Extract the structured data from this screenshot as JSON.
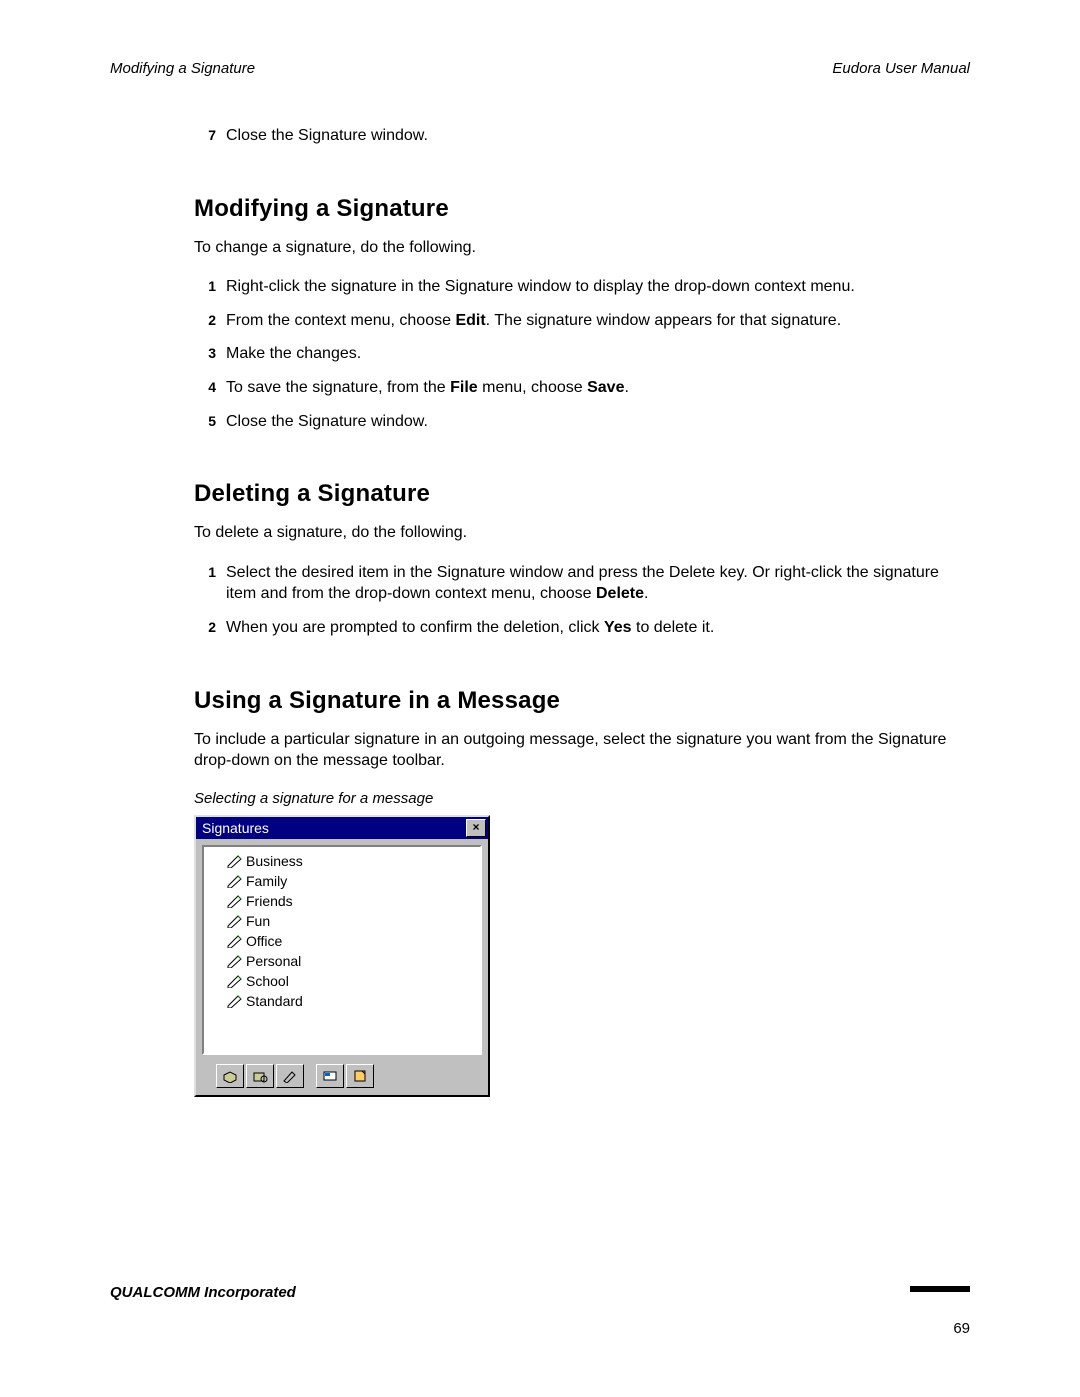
{
  "header": {
    "left": "Modifying a Signature",
    "right": "Eudora User Manual"
  },
  "top_step": {
    "num": "7",
    "text": "Close the Signature window."
  },
  "sections": {
    "modify": {
      "heading": "Modifying a Signature",
      "intro": "To change a signature, do the following.",
      "steps": [
        {
          "num": "1",
          "text": "Right-click the signature in the Signature window to display the drop-down context menu."
        },
        {
          "num": "2",
          "pre": "From the context menu, choose ",
          "b1": "Edit",
          "post": ". The signature window appears for that signature."
        },
        {
          "num": "3",
          "text": "Make the changes."
        },
        {
          "num": "4",
          "pre": "To save the signature, from the ",
          "b1": "File",
          "mid": " menu, choose ",
          "b2": "Save",
          "post": "."
        },
        {
          "num": "5",
          "text": "Close the Signature window."
        }
      ]
    },
    "delete": {
      "heading": "Deleting a Signature",
      "intro": "To delete a signature, do the following.",
      "steps": [
        {
          "num": "1",
          "pre": "Select the desired item in the Signature window and press the Delete key. Or right-click the signature item and from the drop-down context menu, choose ",
          "b1": "Delete",
          "post": "."
        },
        {
          "num": "2",
          "pre": "When you are prompted to confirm the deletion, click ",
          "b1": "Yes",
          "post": " to delete it."
        }
      ]
    },
    "using": {
      "heading": "Using a Signature in a Message",
      "intro": "To include a particular signature in an outgoing message, select the signature you want from the Signature drop-down on the message toolbar.",
      "caption": "Selecting a signature for a message"
    }
  },
  "sig_panel": {
    "title": "Signatures",
    "close": "×",
    "items": [
      "Business",
      "Family",
      "Friends",
      "Fun",
      "Office",
      "Personal",
      "School",
      "Standard"
    ]
  },
  "footer": {
    "company": "QUALCOMM Incorporated",
    "page": "69"
  }
}
